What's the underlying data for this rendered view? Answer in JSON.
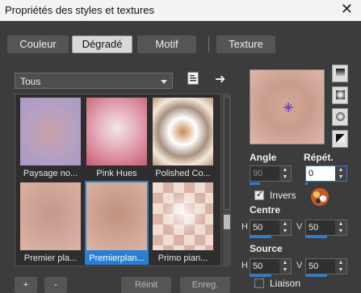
{
  "window": {
    "title": "Propriétés des styles et textures",
    "close_glyph": "✕"
  },
  "tabs": [
    {
      "label": "Couleur"
    },
    {
      "label": "Dégradé",
      "active": true
    },
    {
      "label": "Motif"
    },
    {
      "label": "Texture"
    }
  ],
  "category_dropdown": {
    "value": "Tous"
  },
  "toolbar": {
    "doc_icon": "document-icon",
    "arrow_icon": "arrow-right-icon",
    "arrow_glyph": "➜"
  },
  "gradients": [
    {
      "label": "Paysage no..."
    },
    {
      "label": "Pink Hues"
    },
    {
      "label": "Polished Co..."
    },
    {
      "label": "Premier pla..."
    },
    {
      "label": "Premierplan...",
      "selected": true
    },
    {
      "label": "Primo pian..."
    }
  ],
  "angle": {
    "label": "Angle",
    "value": "90",
    "disabled": true,
    "fill": 0.25
  },
  "repeat": {
    "label": "Répét.",
    "value": "0"
  },
  "invert": {
    "label": "Invers",
    "checked": true
  },
  "centre": {
    "label": "Centre",
    "h_label": "H",
    "h_value": "50",
    "v_label": "V",
    "v_value": "50"
  },
  "source": {
    "label": "Source",
    "h_label": "H",
    "h_value": "50",
    "v_label": "V",
    "v_value": "50"
  },
  "link": {
    "label": "Liaison"
  },
  "bottom": {
    "add": "+",
    "remove": "-",
    "reset": "Réinit",
    "save": "Enreg."
  },
  "colors": {
    "accent": "#2a7fd4",
    "background": "#3c3c3c",
    "preview": "#d0a595"
  }
}
